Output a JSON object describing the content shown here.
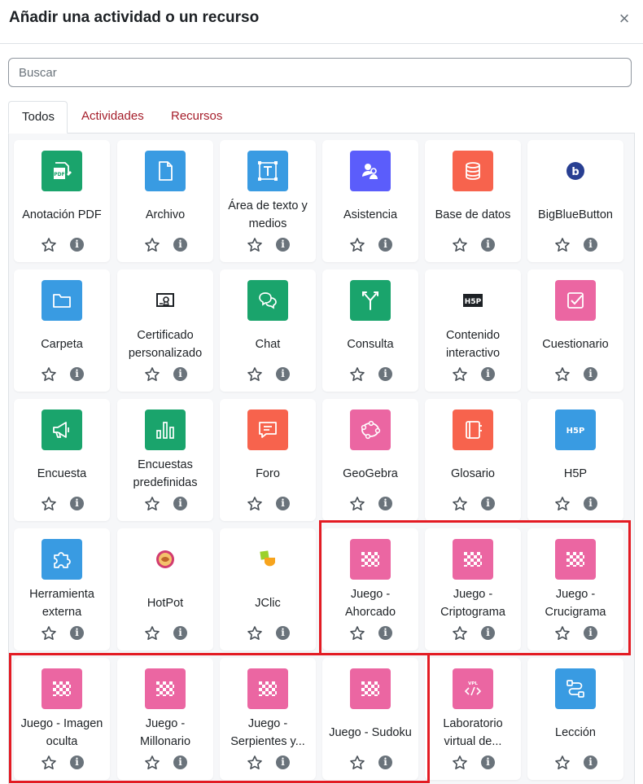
{
  "dialog": {
    "title": "Añadir una actividad o un recurso",
    "close_glyph": "×"
  },
  "search": {
    "placeholder": "Buscar",
    "value": ""
  },
  "tabs": [
    {
      "label": "Todos"
    },
    {
      "label": "Actividades"
    },
    {
      "label": "Recursos"
    }
  ],
  "info_glyph": "i",
  "items": [
    {
      "label": "Anotación PDF",
      "icon": "pdf-annotation",
      "color": "#1aa46c"
    },
    {
      "label": "Archivo",
      "icon": "file",
      "color": "#399be2"
    },
    {
      "label": "Área de texto y medios",
      "icon": "text-area",
      "color": "#399be2"
    },
    {
      "label": "Asistencia",
      "icon": "attendance",
      "color": "#5b5dfb"
    },
    {
      "label": "Base de datos",
      "icon": "database",
      "color": "#f7634d"
    },
    {
      "label": "BigBlueButton",
      "icon": "bigbluebutton",
      "color": "#ffffff"
    },
    {
      "label": "Carpeta",
      "icon": "folder",
      "color": "#399be2"
    },
    {
      "label": "Certificado personalizado",
      "icon": "certificate",
      "color": "#ffffff"
    },
    {
      "label": "Chat",
      "icon": "chat",
      "color": "#1aa46c"
    },
    {
      "label": "Consulta",
      "icon": "choice",
      "color": "#1aa46c"
    },
    {
      "label": "Contenido interactivo",
      "icon": "h5p-black",
      "color": "#ffffff"
    },
    {
      "label": "Cuestionario",
      "icon": "quiz",
      "color": "#eb66a2"
    },
    {
      "label": "Encuesta",
      "icon": "feedback",
      "color": "#1aa46c"
    },
    {
      "label": "Encuestas predefinidas",
      "icon": "survey",
      "color": "#1aa46c"
    },
    {
      "label": "Foro",
      "icon": "forum",
      "color": "#f7634d"
    },
    {
      "label": "GeoGebra",
      "icon": "geogebra",
      "color": "#eb66a2"
    },
    {
      "label": "Glosario",
      "icon": "glossary",
      "color": "#f7634d"
    },
    {
      "label": "H5P",
      "icon": "h5p",
      "color": "#399be2"
    },
    {
      "label": "Herramienta externa",
      "icon": "puzzle",
      "color": "#399be2"
    },
    {
      "label": "HotPot",
      "icon": "hotpot",
      "color": "#ffffff"
    },
    {
      "label": "JClic",
      "icon": "jclic",
      "color": "#ffffff"
    },
    {
      "label": "Juego - Ahorcado",
      "icon": "game",
      "color": "#eb66a2"
    },
    {
      "label": "Juego - Criptograma",
      "icon": "game",
      "color": "#eb66a2"
    },
    {
      "label": "Juego - Crucigrama",
      "icon": "game",
      "color": "#eb66a2"
    },
    {
      "label": "Juego - Imagen oculta",
      "icon": "game",
      "color": "#eb66a2"
    },
    {
      "label": "Juego - Millonario",
      "icon": "game",
      "color": "#eb66a2"
    },
    {
      "label": "Juego - Serpientes y...",
      "icon": "game",
      "color": "#eb66a2"
    },
    {
      "label": "Juego - Sudoku",
      "icon": "game",
      "color": "#eb66a2"
    },
    {
      "label": "Laboratorio virtual de...",
      "icon": "vpl",
      "color": "#eb66a2"
    },
    {
      "label": "Lección",
      "icon": "lesson",
      "color": "#399be2"
    }
  ],
  "highlight_color": "#e31b23"
}
